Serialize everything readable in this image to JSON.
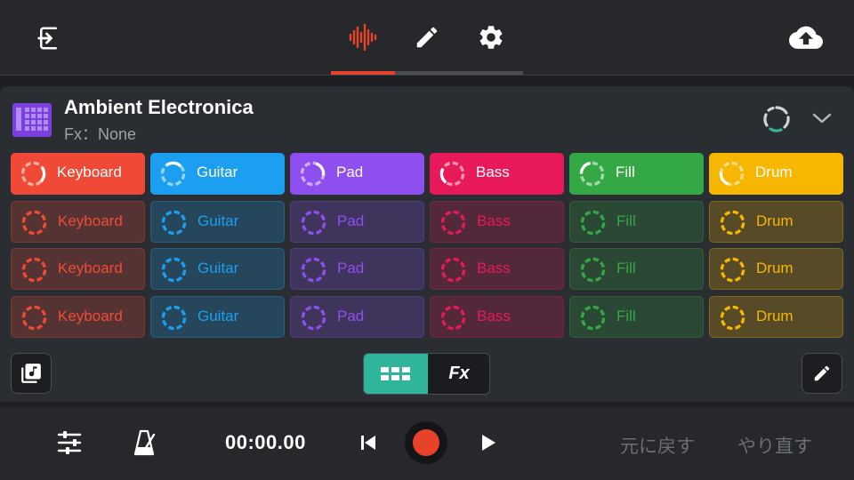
{
  "top_tabs": [
    {
      "name": "waveform",
      "active": true
    },
    {
      "name": "edit",
      "active": false
    },
    {
      "name": "settings",
      "active": false
    }
  ],
  "colors": {
    "accent": "#e8432a",
    "keyboard": "#f04a36",
    "guitar": "#1c9ff0",
    "pad": "#8f4ef0",
    "bass": "#e8195a",
    "fill": "#34a844",
    "drum": "#f7b600",
    "toggle_active": "#2fb59a"
  },
  "kit": {
    "name": "Ambient Electronica",
    "fx": "Fx：None"
  },
  "columns": [
    {
      "key": "keyboard",
      "label": "Keyboard"
    },
    {
      "key": "guitar",
      "label": "Guitar"
    },
    {
      "key": "pad",
      "label": "Pad"
    },
    {
      "key": "bass",
      "label": "Bass"
    },
    {
      "key": "fill",
      "label": "Fill"
    },
    {
      "key": "drum",
      "label": "Drum"
    }
  ],
  "rows": 4,
  "active_row": 0,
  "view_toggle": {
    "grid_label": "grid",
    "fx_label": "Fx"
  },
  "transport": {
    "time": "00:00.00",
    "undo": "元に戻す",
    "redo": "やり直す"
  }
}
